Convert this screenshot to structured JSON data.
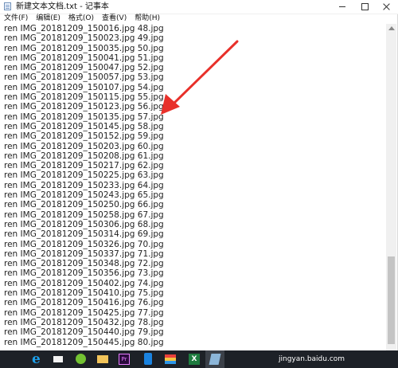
{
  "window": {
    "title": "新建文本文档.txt - 记事本",
    "menu": [
      "文件(F)",
      "编辑(E)",
      "格式(O)",
      "查看(V)",
      "帮助(H)"
    ]
  },
  "lines": [
    "ren IMG_20181209_150016.jpg 48.jpg",
    "ren IMG_20181209_150023.jpg 49.jpg",
    "ren IMG_20181209_150035.jpg 50.jpg",
    "ren IMG_20181209_150041.jpg 51.jpg",
    "ren IMG_20181209_150047.jpg 52.jpg",
    "ren IMG_20181209_150057.jpg 53.jpg",
    "ren IMG_20181209_150107.jpg 54.jpg",
    "ren IMG_20181209_150115.jpg 55.jpg",
    "ren IMG_20181209_150123.jpg 56.jpg",
    "ren IMG_20181209_150135.jpg 57.jpg",
    "ren IMG_20181209_150145.jpg 58.jpg",
    "ren IMG_20181209_150152.jpg 59.jpg",
    "ren IMG_20181209_150203.jpg 60.jpg",
    "ren IMG_20181209_150208.jpg 61.jpg",
    "ren IMG_20181209_150217.jpg 62.jpg",
    "ren IMG_20181209_150225.jpg 63.jpg",
    "ren IMG_20181209_150233.jpg 64.jpg",
    "ren IMG_20181209_150243.jpg 65.jpg",
    "ren IMG_20181209_150250.jpg 66.jpg",
    "ren IMG_20181209_150258.jpg 67.jpg",
    "ren IMG_20181209_150306.jpg 68.jpg",
    "ren IMG_20181209_150314.jpg 69.jpg",
    "ren IMG_20181209_150326.jpg 70.jpg",
    "ren IMG_20181209_150337.jpg 71.jpg",
    "ren IMG_20181209_150348.jpg 72.jpg",
    "ren IMG_20181209_150356.jpg 73.jpg",
    "ren IMG_20181209_150402.jpg 74.jpg",
    "ren IMG_20181209_150410.jpg 75.jpg",
    "ren IMG_20181209_150416.jpg 76.jpg",
    "ren IMG_20181209_150425.jpg 77.jpg",
    "ren IMG_20181209_150432.jpg 78.jpg",
    "ren IMG_20181209_150440.jpg 79.jpg",
    "ren IMG_20181209_150445.jpg 80.jpg"
  ],
  "taskbar": {
    "excel_label": "X",
    "pr_label": "Pr",
    "ie_label": "e"
  },
  "watermark": "jingyan.baidu.com",
  "colors": {
    "annotation_arrow": "#e8302a",
    "taskbar": "#1d2127"
  },
  "icons": [
    "notepad-icon",
    "minimize-icon",
    "maximize-icon",
    "close-icon",
    "edge-icon",
    "mail-icon",
    "browser-360-icon",
    "file-explorer-icon",
    "premiere-icon",
    "phone-icon",
    "flag-app-icon",
    "excel-icon",
    "notepad-taskbar-icon"
  ]
}
